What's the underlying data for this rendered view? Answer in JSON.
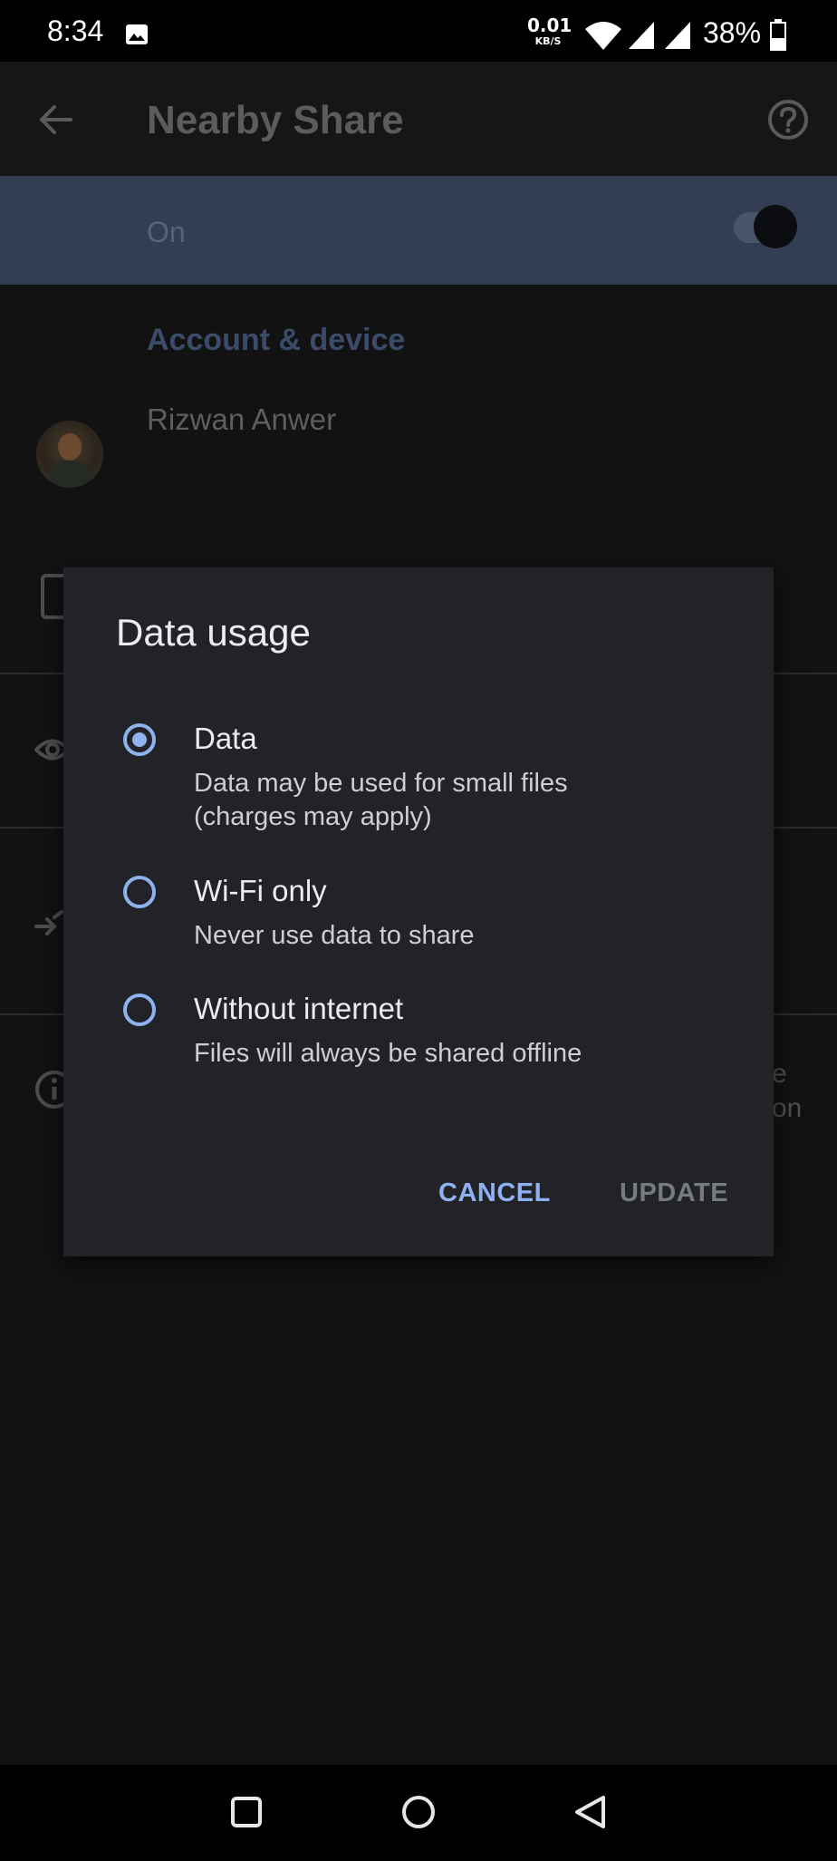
{
  "status_bar": {
    "time": "8:34",
    "net_speed_value": "0.01",
    "net_speed_unit": "KB/S",
    "battery": "38%",
    "icons": [
      "image-notification-icon",
      "wifi-icon",
      "signal-icon",
      "signal-icon",
      "battery-icon"
    ]
  },
  "app_bar": {
    "title": "Nearby Share",
    "icons": [
      "back-arrow-icon",
      "help-icon"
    ]
  },
  "main_toggle": {
    "label": "On",
    "state": "on"
  },
  "account_section": {
    "title": "Account & device",
    "account_name": "Rizwan Anwer"
  },
  "background_partial_text": {
    "line1": "e",
    "line2": "on"
  },
  "dialog": {
    "title": "Data usage",
    "options": [
      {
        "label": "Data",
        "description": "Data may be used for small files (charges may apply)",
        "desc_line1": "Data may be used for small files",
        "desc_line2": "(charges may apply)",
        "selected": true
      },
      {
        "label": "Wi-Fi only",
        "description": "Never use data to share",
        "selected": false
      },
      {
        "label": "Without internet",
        "description": "Files will always be shared offline",
        "selected": false
      }
    ],
    "cancel_label": "CANCEL",
    "update_label": "UPDATE"
  },
  "colors": {
    "accent": "#8fb1f0",
    "dialog_bg": "#212328",
    "page_bg": "#121212"
  }
}
